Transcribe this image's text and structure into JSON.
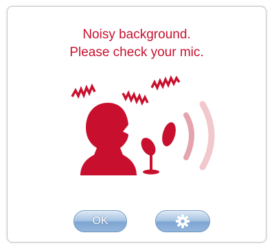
{
  "dialog": {
    "message_line1": "Noisy background.",
    "message_line2": "Please check your mic."
  },
  "buttons": {
    "ok_label": "OK",
    "settings_icon": "gear-icon"
  },
  "colors": {
    "accent_red": "#c8102e",
    "button_blue": "#7ea6d2"
  }
}
